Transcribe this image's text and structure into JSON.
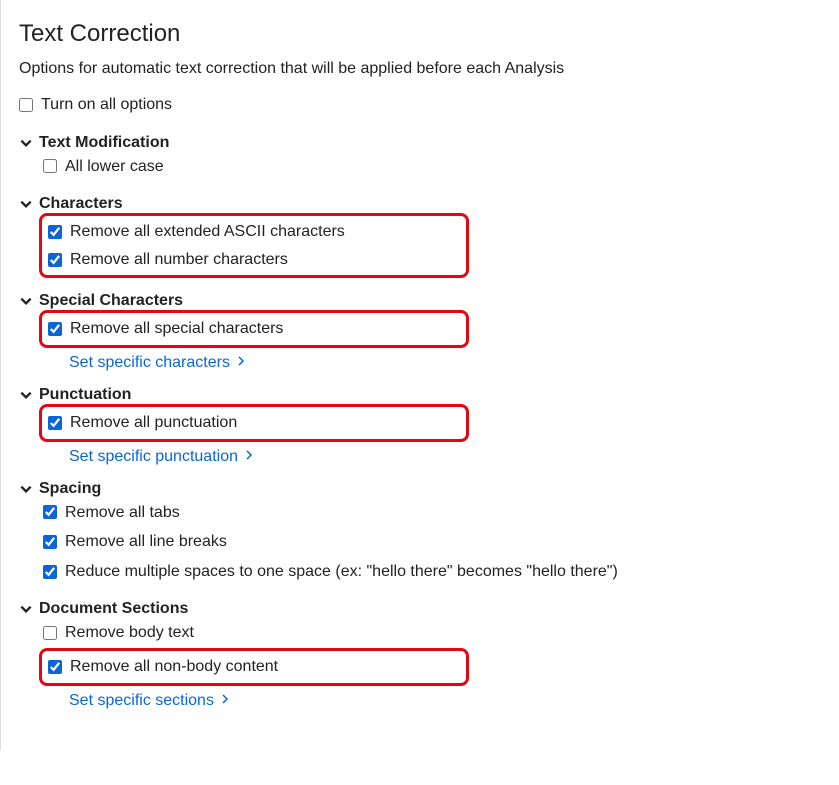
{
  "title": "Text Correction",
  "subtitle": "Options for automatic text correction that will be applied before each Analysis",
  "turn_on_all": {
    "label": "Turn on all options",
    "checked": false
  },
  "sections": {
    "text_mod": {
      "header": "Text Modification",
      "lowercase": {
        "label": "All lower case",
        "checked": false
      }
    },
    "characters": {
      "header": "Characters",
      "ascii": {
        "label": "Remove all extended ASCII characters",
        "checked": true
      },
      "numbers": {
        "label": "Remove all number characters",
        "checked": true
      }
    },
    "special": {
      "header": "Special Characters",
      "remove": {
        "label": "Remove all special characters",
        "checked": true
      },
      "link": "Set specific characters"
    },
    "punctuation": {
      "header": "Punctuation",
      "remove": {
        "label": "Remove all punctuation",
        "checked": true
      },
      "link": "Set specific punctuation"
    },
    "spacing": {
      "header": "Spacing",
      "tabs": {
        "label": "Remove all tabs",
        "checked": true
      },
      "linebreaks": {
        "label": "Remove all line breaks",
        "checked": true
      },
      "multispace": {
        "label": "Reduce multiple spaces to one space (ex: \"hello there\" becomes \"hello there\")",
        "checked": true
      }
    },
    "document": {
      "header": "Document Sections",
      "body": {
        "label": "Remove body text",
        "checked": false
      },
      "nonbody": {
        "label": "Remove all non-body content",
        "checked": true
      },
      "link": "Set specific sections"
    }
  }
}
